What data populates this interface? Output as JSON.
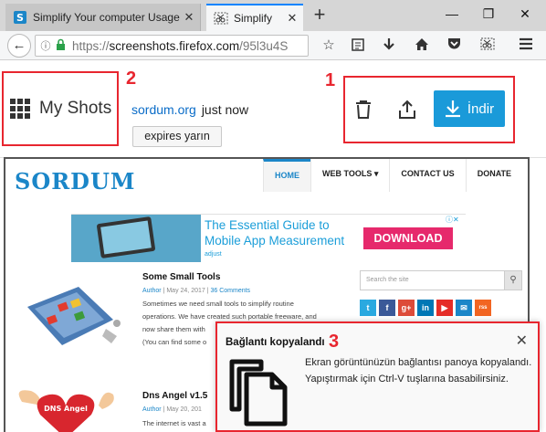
{
  "browser": {
    "tabs": [
      {
        "title": "Simplify Your computer Usage",
        "favicon": "sordum-s-icon"
      },
      {
        "title": "Simplify",
        "favicon": "screenshot-scissors-icon"
      }
    ],
    "new_tab_glyph": "+",
    "window_controls": [
      "—",
      "❐",
      "✕"
    ],
    "url": {
      "scheme": "https://",
      "host": "screenshots.firefox.com",
      "path": "/95l3u4S"
    }
  },
  "shot_header": {
    "my_shots_label": "My Shots",
    "source_link": "sordum.org",
    "time": "just now",
    "expires_label": "expires yarın",
    "download_label": "İndir",
    "annotation_numbers": [
      "1",
      "2",
      "3"
    ],
    "accent_color": "#1a9ad9",
    "highlight_color": "#e8262f"
  },
  "captured_page": {
    "logo": "SORDUM",
    "nav": [
      "HOME",
      "WEB TOOLS ▾",
      "CONTACT US",
      "DONATE"
    ],
    "ad": {
      "headline_1": "The Essential Guide to",
      "headline_2": "Mobile App Measurement",
      "brand": "adjust",
      "button": "DOWNLOAD",
      "ad_badge": "ⓘ✕"
    },
    "posts": [
      {
        "title": "Some Small Tools",
        "author": "Author",
        "date": "May 24, 2017",
        "comments": "36 Comments",
        "lines": [
          "Sometimes we need small tools to simplify routine",
          "operations. We have created such portable freeware, and",
          "now share them with",
          "(You can find some o"
        ]
      },
      {
        "title": "Dns Angel v1.5",
        "author": "Author",
        "date": "May 20, 201",
        "lines": [
          "The internet is vast a"
        ],
        "image_label": "DNS Angel"
      }
    ],
    "search_placeholder": "Search the site",
    "socials": [
      "t",
      "f",
      "g+",
      "in",
      "▶",
      "✉",
      "rss"
    ]
  },
  "notification": {
    "title": "Bağlantı kopyalandı",
    "message": "Ekran görüntünüzün bağlantısı panoya kopyalandı. Yapıştırmak için Ctrl-V tuşlarına basabilirsiniz.",
    "close": "✕"
  }
}
